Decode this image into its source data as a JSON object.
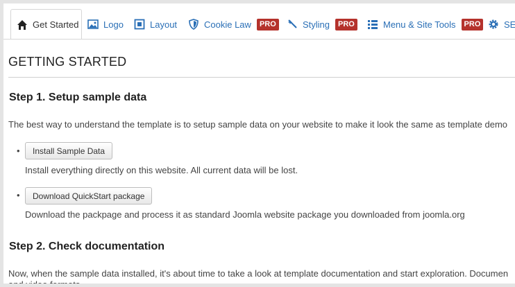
{
  "tabs": [
    {
      "label": "Get Started",
      "icon": "home-icon",
      "pro": false
    },
    {
      "label": "Logo",
      "icon": "image-icon",
      "pro": false
    },
    {
      "label": "Layout",
      "icon": "layout-icon",
      "pro": false
    },
    {
      "label": "Cookie Law",
      "icon": "shield-icon",
      "pro": true
    },
    {
      "label": "Styling",
      "icon": "magic-wand-icon",
      "pro": true
    },
    {
      "label": "Menu & Site Tools",
      "icon": "list-icon",
      "pro": true
    },
    {
      "label": "SE",
      "icon": "gear-icon",
      "pro": false
    }
  ],
  "pro_label": "PRO",
  "page": {
    "title": "GETTING STARTED",
    "step1": {
      "heading": "Step 1. Setup sample data",
      "intro": "The best way to understand the template is to setup sample data on your website to make it look the same as template demo",
      "items": [
        {
          "button": "Install Sample Data",
          "desc": "Install everything directly on this website. All current data will be lost."
        },
        {
          "button": "Download QuickStart package",
          "desc": "Download the packpage and process it as standard Joomla website package you downloaded from joomla.org"
        }
      ]
    },
    "step2": {
      "heading": "Step 2. Check documentation",
      "text": "Now, when the sample data installed, it's about time to take a look at template documentation and start exploration. Documen",
      "text_cont": "and video formats."
    }
  },
  "colors": {
    "link": "#2a6fb6",
    "pro_badge": "#b5322c"
  }
}
